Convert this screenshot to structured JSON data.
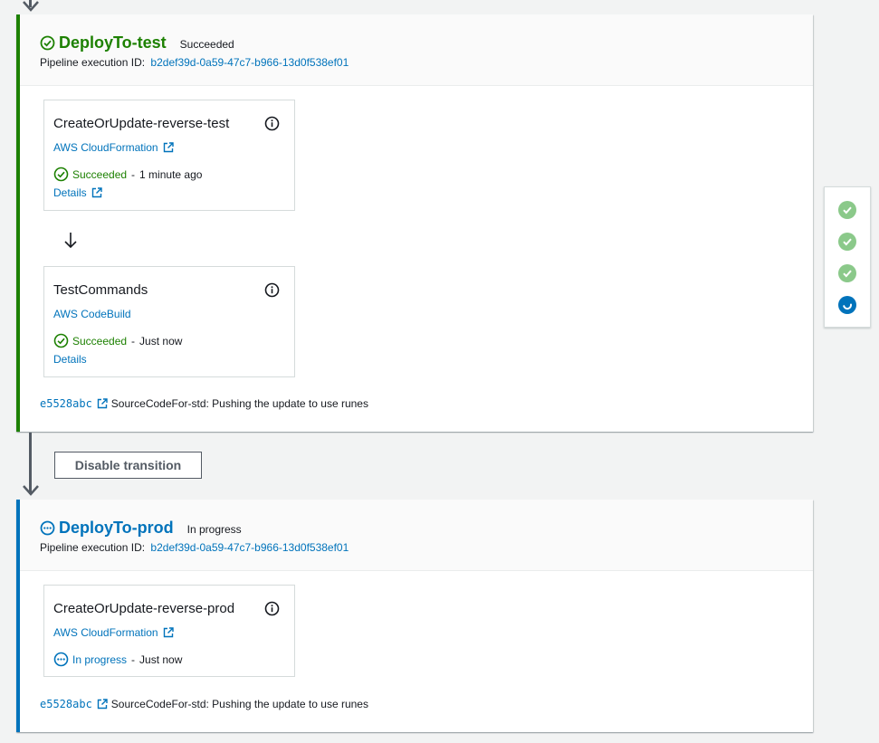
{
  "stages": [
    {
      "name": "DeployTo-test",
      "status": "Succeeded",
      "exec_label": "Pipeline execution ID:",
      "exec_id": "b2def39d-0a59-47c7-b966-13d0f538ef01",
      "actions": [
        {
          "name": "CreateOrUpdate-reverse-test",
          "provider": "AWS CloudFormation",
          "status": "Succeeded",
          "when": "1 minute ago",
          "details": "Details"
        },
        {
          "name": "TestCommands",
          "provider": "AWS CodeBuild",
          "status": "Succeeded",
          "when": "Just now",
          "details": "Details"
        }
      ],
      "source": {
        "commit": "e5528abc",
        "message": "SourceCodeFor-std: Pushing the update to use runes"
      }
    },
    {
      "name": "DeployTo-prod",
      "status": "In progress",
      "exec_label": "Pipeline execution ID:",
      "exec_id": "b2def39d-0a59-47c7-b966-13d0f538ef01",
      "actions": [
        {
          "name": "CreateOrUpdate-reverse-prod",
          "provider": "AWS CloudFormation",
          "status": "In progress",
          "when": "Just now"
        }
      ],
      "source": {
        "commit": "e5528abc",
        "message": "SourceCodeFor-std: Pushing the update to use runes"
      }
    }
  ],
  "transition": {
    "button_label": "Disable transition"
  },
  "stage_overview": [
    {
      "state": "succeeded"
    },
    {
      "state": "succeeded"
    },
    {
      "state": "succeeded"
    },
    {
      "state": "in-progress"
    }
  ],
  "colors": {
    "success": "#1d8102",
    "in_progress": "#0073bb",
    "link": "#0073bb",
    "connector": "#545b64"
  },
  "icons": {
    "success": "check-circle-icon",
    "in_progress": "ellipsis-circle-icon",
    "info": "info-icon",
    "external": "external-link-icon",
    "arrow": "arrow-down-icon"
  }
}
